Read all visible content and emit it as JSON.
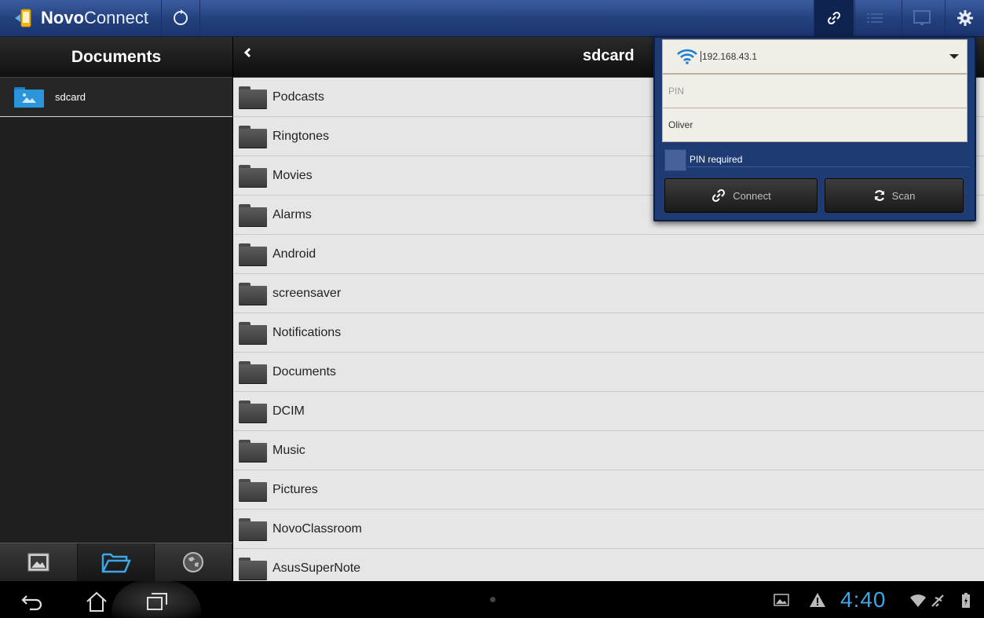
{
  "app": {
    "name_bold": "Novo",
    "name_light": "Connect"
  },
  "left": {
    "title": "Documents",
    "items": [
      {
        "label": "sdcard"
      }
    ]
  },
  "right": {
    "title": "sdcard",
    "folders": [
      "Podcasts",
      "Ringtones",
      "Movies",
      "Alarms",
      "Android",
      "screensaver",
      "Notifications",
      "Documents",
      "DCIM",
      "Music",
      "Pictures",
      "NovoClassroom",
      "AsusSuperNote"
    ]
  },
  "connect_popup": {
    "server_ip": "192.168.43.1",
    "pin_placeholder": "PIN",
    "pin_value": "",
    "user_name": "Oliver",
    "pin_required_label": "PIN required",
    "pin_required_checked": false,
    "connect_label": "Connect",
    "scan_label": "Scan"
  },
  "status": {
    "time": "4:40"
  },
  "colors": {
    "accent": "#3aa8e8",
    "actionbar": "#223f7c",
    "popup": "#1f3b74"
  },
  "icons": {
    "topbar": [
      "app-logo-icon",
      "refresh-icon",
      "link-icon",
      "list-icon",
      "screen-icon",
      "settings-icon"
    ],
    "left_tabs": [
      "image-icon",
      "folder-open-icon",
      "globe-icon"
    ],
    "nav": [
      "back-icon",
      "home-icon",
      "recent-apps-icon"
    ]
  }
}
